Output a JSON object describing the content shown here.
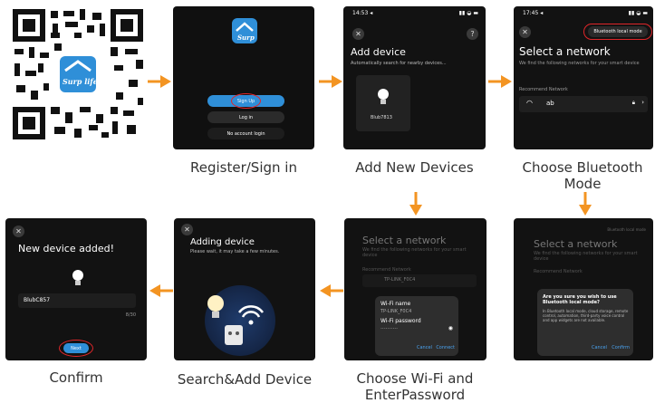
{
  "captions": {
    "register": "Register/Sign in",
    "add_new": "Add New Devices",
    "choose_bt_1": "Choose Bluetooth",
    "choose_bt_2": "Mode",
    "confirm": "Confirm",
    "search_add": "Search&Add  Device",
    "choose_wifi_1": "Choose Wi-Fi and",
    "choose_wifi_2": "EnterPassword"
  },
  "brand": {
    "logo_text": "Surp life",
    "accent": "#f39422",
    "red": "#e0262a",
    "blue": "#2f8fd8"
  },
  "screen1": {
    "signup": "Sign Up",
    "login": "Log in",
    "no_account": "No account login"
  },
  "screen2": {
    "time": "14:53 ◂",
    "title": "Add device",
    "subtitle": "Automatically search for nearby devices...",
    "device": "Blub7813",
    "help": "?"
  },
  "screen3": {
    "time": "17:45 ◂",
    "bt_mode": "Bluetooth local mode",
    "title": "Select a network",
    "subtitle": "We find the following networks for your smart device",
    "section": "Recommend Network",
    "network": "ab"
  },
  "screen4": {
    "title": "Select a network",
    "subtitle": "We find the following networks for your smart device",
    "section": "Recommend Network",
    "network": "TP-LINK_F0C4",
    "modal": {
      "wifi_label": "Wi-Fi name",
      "wifi_value": "TP-LINK_F0C4",
      "pwd_label": "Wi-Fi password",
      "pwd_value": "··········",
      "cancel": "Cancel",
      "connect": "Connect"
    }
  },
  "screen5": {
    "bt_mode": "Bluetooth local mode",
    "title": "Select a network",
    "subtitle": "We find the following networks for your smart device",
    "section": "Recommend Network",
    "modal": {
      "question": "Are you sure you wish to use Bluetooth local mode?",
      "body": "In Bluetooth local mode, cloud storage, remote control, automation, third-party voice control and app widgets are not available.",
      "cancel": "Cancel",
      "confirm": "Confirm"
    }
  },
  "screen6": {
    "title": "Adding device",
    "subtitle": "Please wait, it may take a few minutes."
  },
  "screen7": {
    "title": "New device added!",
    "device_name": "BlubC857",
    "counter": "8/30",
    "next": "Next"
  }
}
